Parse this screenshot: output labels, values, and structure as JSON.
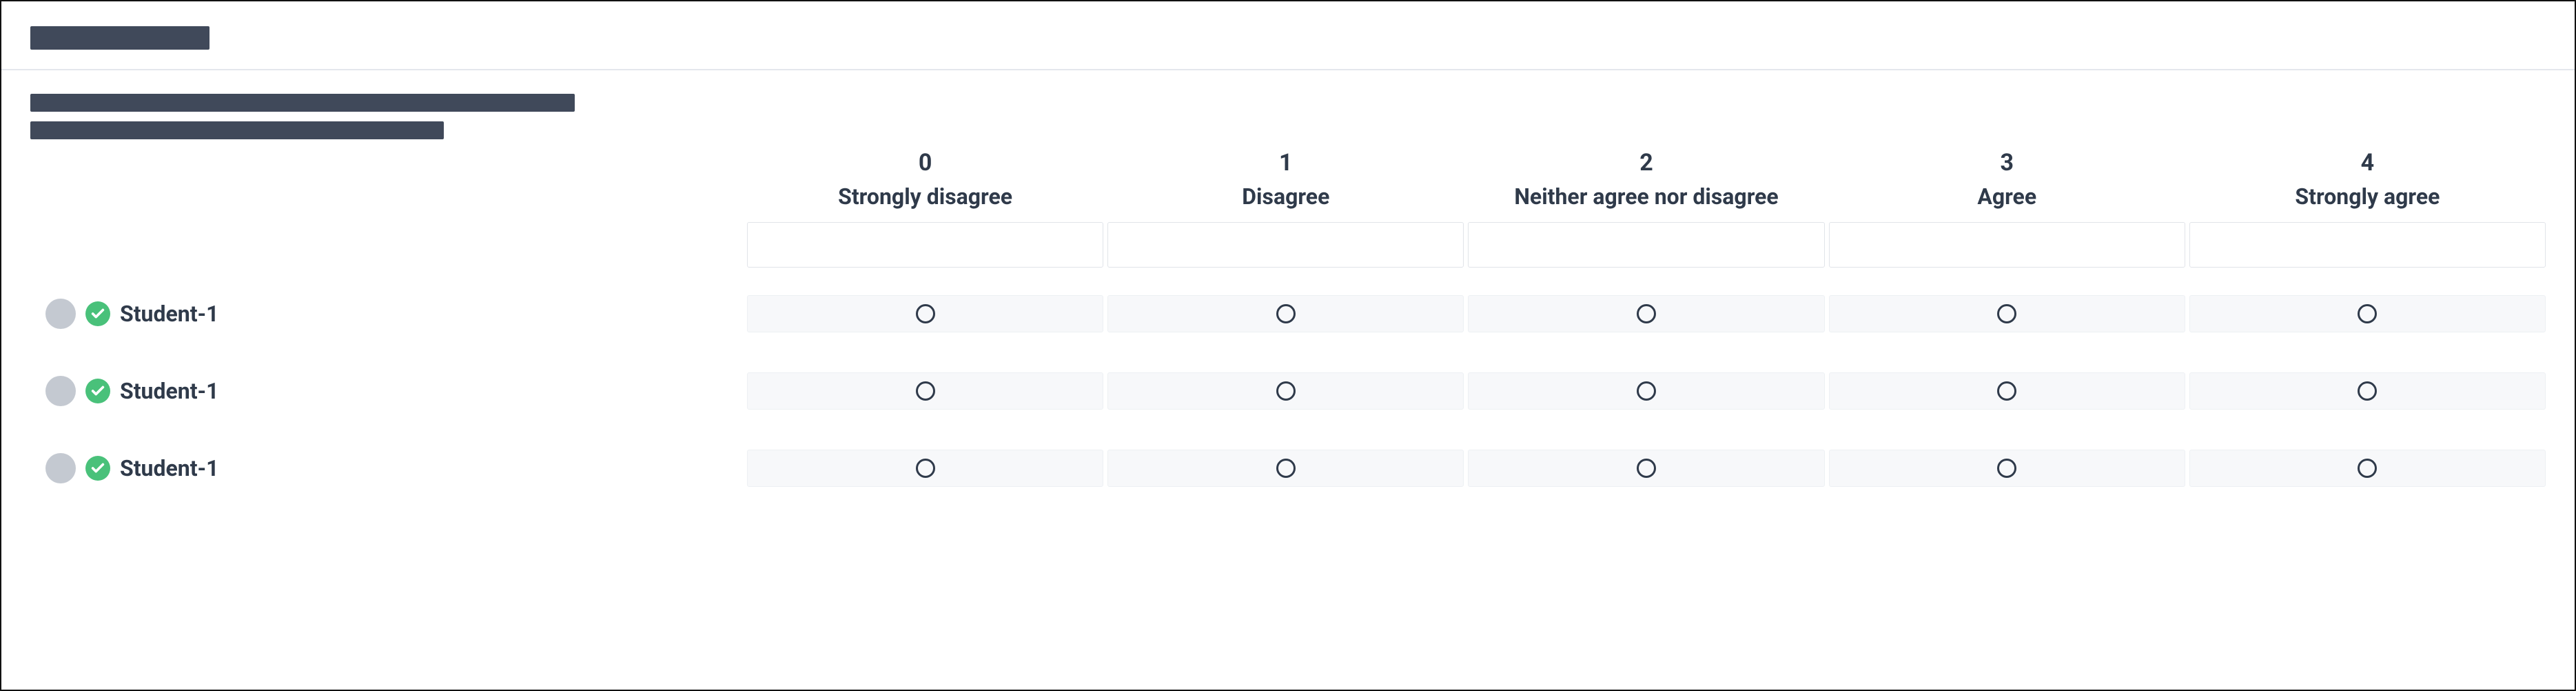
{
  "scale": {
    "options": [
      {
        "value": "0",
        "label": "Strongly disagree"
      },
      {
        "value": "1",
        "label": "Disagree"
      },
      {
        "value": "2",
        "label": "Neither agree nor disagree"
      },
      {
        "value": "3",
        "label": "Agree"
      },
      {
        "value": "4",
        "label": "Strongly agree"
      }
    ]
  },
  "students": [
    {
      "name": "Student-1"
    },
    {
      "name": "Student-1"
    },
    {
      "name": "Student-1"
    }
  ]
}
